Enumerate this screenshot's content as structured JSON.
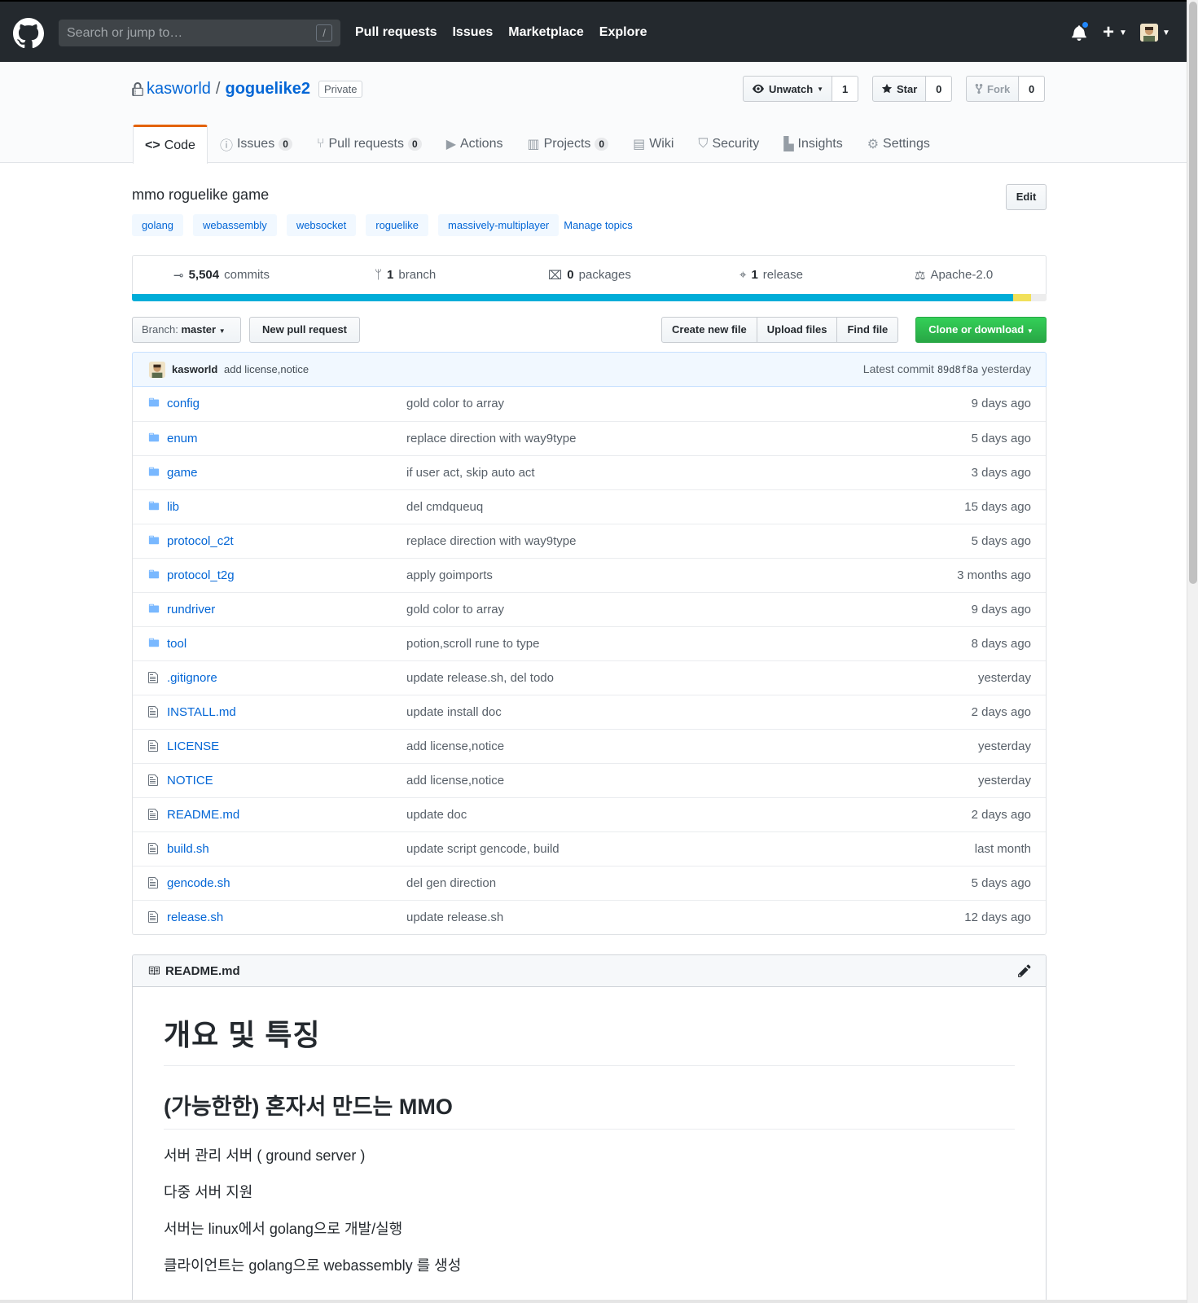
{
  "header": {
    "search_placeholder": "Search or jump to…",
    "slash": "/",
    "nav": [
      "Pull requests",
      "Issues",
      "Marketplace",
      "Explore"
    ],
    "plus": "+"
  },
  "repo": {
    "owner": "kasworld",
    "separator": "/",
    "name": "goguelike2",
    "visibility": "Private",
    "unwatch_label": "Unwatch",
    "watch_count": "1",
    "star_label": "Star",
    "star_count": "0",
    "fork_label": "Fork",
    "fork_count": "0"
  },
  "tabs": [
    {
      "label": "Code",
      "icon": "code-icon"
    },
    {
      "label": "Issues",
      "count": "0",
      "icon": "issue-icon"
    },
    {
      "label": "Pull requests",
      "count": "0",
      "icon": "pull-request-icon"
    },
    {
      "label": "Actions",
      "icon": "play-icon"
    },
    {
      "label": "Projects",
      "count": "0",
      "icon": "project-icon"
    },
    {
      "label": "Wiki",
      "icon": "book-icon"
    },
    {
      "label": "Security",
      "icon": "shield-icon"
    },
    {
      "label": "Insights",
      "icon": "graph-icon"
    },
    {
      "label": "Settings",
      "icon": "gear-icon"
    }
  ],
  "about": {
    "description": "mmo roguelike game",
    "edit_label": "Edit",
    "topics": [
      "golang",
      "webassembly",
      "websocket",
      "roguelike",
      "massively-multiplayer"
    ],
    "manage_topics": "Manage topics"
  },
  "summary": {
    "commits_num": "5,504",
    "commits_label": "commits",
    "branch_num": "1",
    "branch_label": "branch",
    "packages_num": "0",
    "packages_label": "packages",
    "release_num": "1",
    "release_label": "release",
    "license": "Apache-2.0"
  },
  "languages": {
    "colors": [
      "#00add8",
      "#f1e05a",
      "#ededed"
    ]
  },
  "filenav": {
    "branch_prefix": "Branch:",
    "branch_name": "master",
    "new_pr": "New pull request",
    "create_file": "Create new file",
    "upload_files": "Upload files",
    "find_file": "Find file",
    "clone": "Clone or download"
  },
  "commit": {
    "author": "kasworld",
    "message": "add license,notice",
    "latest_label": "Latest commit",
    "sha": "89d8f8a",
    "time": "yesterday"
  },
  "files": [
    {
      "type": "dir",
      "name": "config",
      "message": "gold color to array",
      "age": "9 days ago"
    },
    {
      "type": "dir",
      "name": "enum",
      "message": "replace direction with way9type",
      "age": "5 days ago"
    },
    {
      "type": "dir",
      "name": "game",
      "message": "if user act, skip auto act",
      "age": "3 days ago"
    },
    {
      "type": "dir",
      "name": "lib",
      "message": "del cmdqueuq",
      "age": "15 days ago"
    },
    {
      "type": "dir",
      "name": "protocol_c2t",
      "message": "replace direction with way9type",
      "age": "5 days ago"
    },
    {
      "type": "dir",
      "name": "protocol_t2g",
      "message": "apply goimports",
      "age": "3 months ago"
    },
    {
      "type": "dir",
      "name": "rundriver",
      "message": "gold color to array",
      "age": "9 days ago"
    },
    {
      "type": "dir",
      "name": "tool",
      "message": "potion,scroll rune to type",
      "age": "8 days ago"
    },
    {
      "type": "file",
      "name": ".gitignore",
      "message": "update release.sh, del todo",
      "age": "yesterday"
    },
    {
      "type": "file",
      "name": "INSTALL.md",
      "message": "update install doc",
      "age": "2 days ago"
    },
    {
      "type": "file",
      "name": "LICENSE",
      "message": "add license,notice",
      "age": "yesterday"
    },
    {
      "type": "file",
      "name": "NOTICE",
      "message": "add license,notice",
      "age": "yesterday"
    },
    {
      "type": "file",
      "name": "README.md",
      "message": "update doc",
      "age": "2 days ago"
    },
    {
      "type": "file",
      "name": "build.sh",
      "message": "update script gencode, build",
      "age": "last month"
    },
    {
      "type": "file",
      "name": "gencode.sh",
      "message": "del gen direction",
      "age": "5 days ago"
    },
    {
      "type": "file",
      "name": "release.sh",
      "message": "update release.sh",
      "age": "12 days ago"
    }
  ],
  "readme": {
    "filename": "README.md",
    "h1": "개요 및 특징",
    "h2": "(가능한한) 혼자서 만드는 MMO",
    "paragraphs": [
      "서버 관리 서버 ( ground server )",
      "다중 서버 지원",
      "서버는 linux에서 golang으로 개발/실행",
      "클라이언트는 golang으로 webassembly 를 생성"
    ]
  }
}
